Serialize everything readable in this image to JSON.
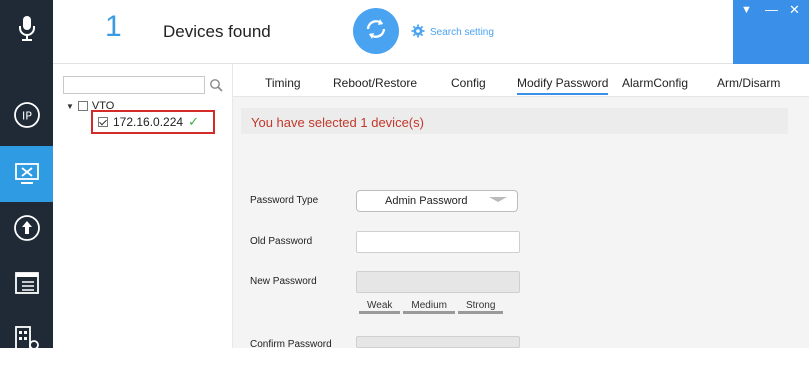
{
  "header": {
    "device_count": "1",
    "devices_found_label": "Devices found",
    "search_setting_label": "Search setting"
  },
  "sidebar": {
    "items": [
      {
        "icon": "microphone-icon"
      },
      {
        "icon": "ip-icon"
      },
      {
        "icon": "device-config-icon",
        "active": true
      },
      {
        "icon": "upgrade-icon"
      },
      {
        "icon": "window-list-icon"
      },
      {
        "icon": "building-config-icon"
      }
    ]
  },
  "tree": {
    "search_placeholder": "",
    "root_label": "VTO",
    "child_label": "172.16.0.224"
  },
  "tabs": [
    "Timing",
    "Reboot/Restore",
    "Config",
    "Modify Password",
    "AlarmConfig",
    "Arm/Disarm"
  ],
  "active_tab": "Modify Password",
  "main": {
    "selected_message": "You have selected 1 device(s)",
    "password_type_label": "Password Type",
    "password_type_value": "Admin Password",
    "old_password_label": "Old Password",
    "new_password_label": "New Password",
    "strength": {
      "weak": "Weak",
      "medium": "Medium",
      "strong": "Strong"
    },
    "confirm_password_label": "Confirm Password"
  },
  "colors": {
    "sidebar_bg": "#1f2a36",
    "accent": "#3a8fe8",
    "error_red": "#c0392b",
    "success_green": "#3fae49"
  }
}
